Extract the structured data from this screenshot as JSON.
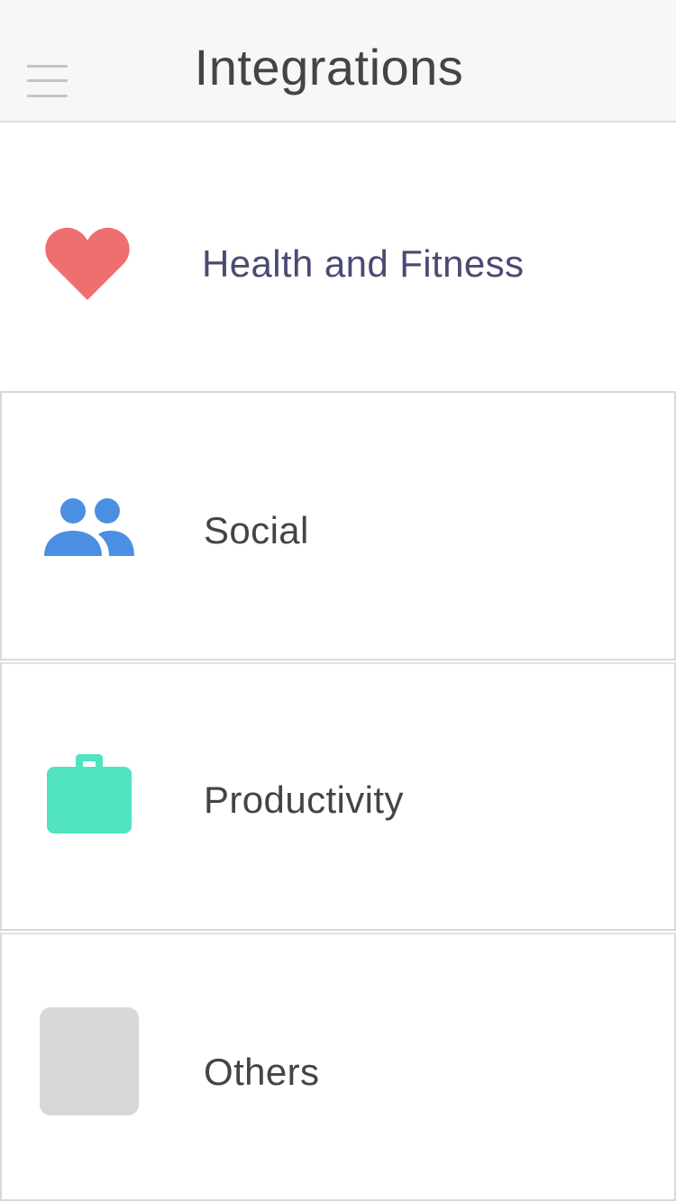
{
  "header": {
    "title": "Integrations",
    "menu_icon": "hamburger-menu-icon"
  },
  "categories": [
    {
      "label": "Health and Fitness",
      "icon": "heart-icon",
      "icon_color": "#ef6f6f",
      "label_color": "#4a4a72"
    },
    {
      "label": "Social",
      "icon": "people-icon",
      "icon_color": "#4a8fe2",
      "label_color": "#444444"
    },
    {
      "label": "Productivity",
      "icon": "briefcase-icon",
      "icon_color": "#52e3c2",
      "label_color": "#444444"
    },
    {
      "label": "Others",
      "icon": "placeholder-square-icon",
      "icon_color": "#d8d8d8",
      "label_color": "#444444"
    }
  ],
  "colors": {
    "header_bg": "#f7f7f7",
    "divider": "#d9d9d9",
    "text": "#444444"
  }
}
